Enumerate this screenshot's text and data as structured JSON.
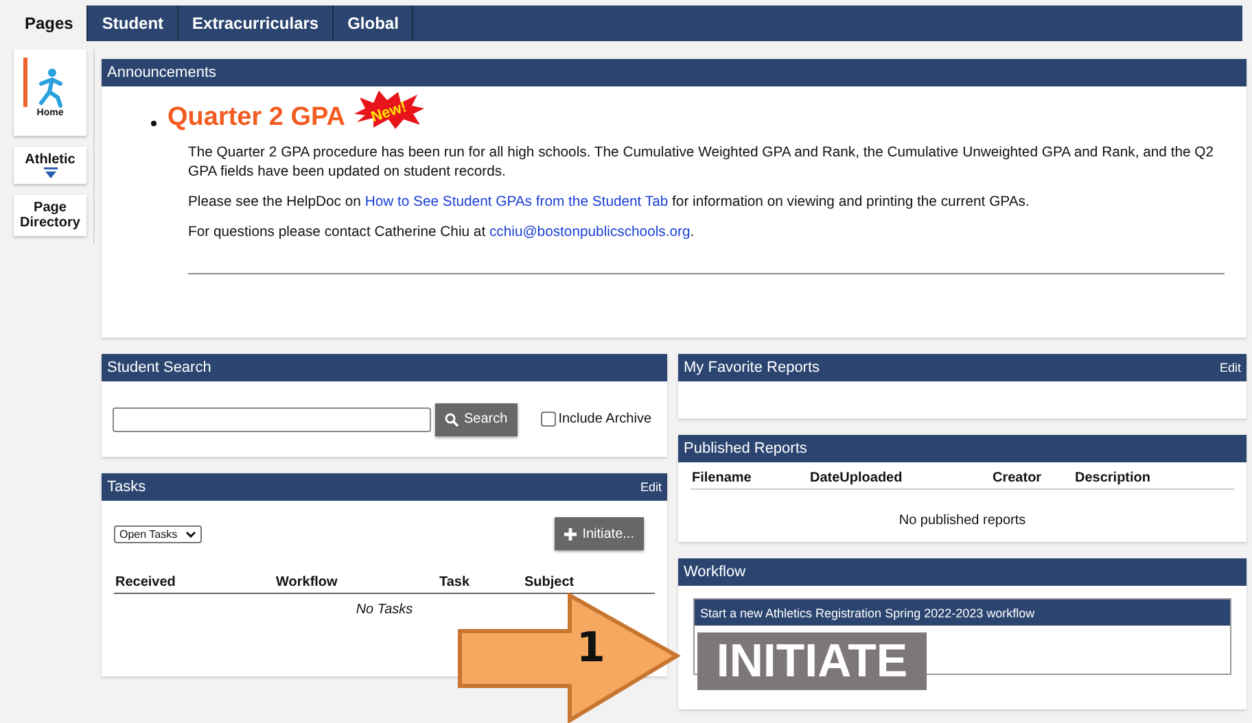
{
  "tabs": [
    {
      "label": "Pages",
      "selected": true
    },
    {
      "label": "Student",
      "selected": false
    },
    {
      "label": "Extracurriculars",
      "selected": false
    },
    {
      "label": "Global",
      "selected": false
    }
  ],
  "sidebar": {
    "items": [
      {
        "label": "Home",
        "kind": "icon",
        "selected": true
      },
      {
        "label": "Athletic",
        "kind": "dropdown",
        "selected": false
      },
      {
        "label": "Page Directory",
        "kind": "plain",
        "selected": false
      }
    ]
  },
  "announcements": {
    "title": "Announcements",
    "headline": "Quarter 2 GPA",
    "badge": "New!",
    "paragraphs": [
      {
        "text": "The Quarter 2 GPA procedure has been run for all high schools. The Cumulative Weighted GPA and Rank, the Cumulative Unweighted GPA and Rank, and the Q2 GPA fields have been updated on student records."
      },
      {
        "text": "Please see the HelpDoc on ",
        "link": "How to See Student GPAs from the Student Tab",
        "after": " for information on viewing and printing the current GPAs."
      },
      {
        "text": "For questions please contact Catherine Chiu at ",
        "link": "cchiu@bostonpublicschools.org",
        "after": "."
      }
    ]
  },
  "student_search": {
    "title": "Student Search",
    "button": "Search",
    "include_archive": {
      "label": "Include Archive",
      "checked": false
    }
  },
  "tasks": {
    "title": "Tasks",
    "edit": "Edit",
    "filter": "Open Tasks",
    "button": "Initiate...",
    "columns": [
      "Received",
      "Workflow",
      "Task",
      "Subject"
    ],
    "empty": "No Tasks"
  },
  "favorite_reports": {
    "title": "My Favorite Reports",
    "edit": "Edit"
  },
  "published_reports": {
    "title": "Published Reports",
    "columns": [
      "Filename",
      "DateUploaded",
      "Creator",
      "Description"
    ],
    "empty": "No published reports"
  },
  "workflow": {
    "title": "Workflow",
    "item_title": "Start a new Athletics Registration Spring 2022-2023 workflow",
    "button": "INITIATE"
  },
  "annotation": {
    "step": "1"
  }
}
